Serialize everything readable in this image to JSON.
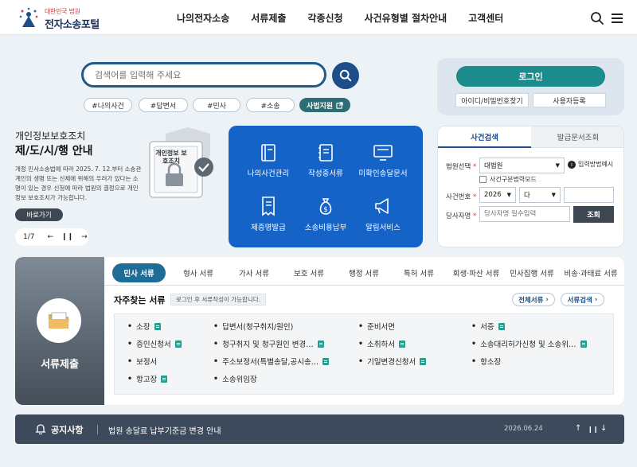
{
  "header": {
    "logo_sub": "대한민국 법원",
    "logo_main": "전자소송포털",
    "nav": [
      "나의전자소송",
      "서류제출",
      "각종신청",
      "사건유형별 절차안내",
      "고객센터"
    ]
  },
  "search": {
    "placeholder": "검색어를 입력해 주세요",
    "tags": [
      "#나의사건",
      "#답변서",
      "#민사",
      "#소송",
      "사법지원"
    ]
  },
  "login": {
    "button": "로그인",
    "find": "아이디/비밀번호찾기",
    "register": "사용자등록"
  },
  "promo": {
    "title1": "개인정보보호조치",
    "title2": "제/도/시/행 안내",
    "body": "개정 민사소송법에 따라 2025. 7. 12.부터 소송관계인의 생명 또는 신체에 위해의 우려가 있다는 소명이 있는 경우 신청에 따라 법원의 결정으로 개인정보 보호조치가 가능합니다.",
    "more": "바로가기",
    "page": "1/7",
    "card_label": "개인정보 보호조치"
  },
  "services": [
    "나의사건관리",
    "작성중서류",
    "미확인송달문서",
    "제증명발급",
    "소송비용납부",
    "알림서비스"
  ],
  "case_search": {
    "tab_active": "사건검색",
    "tab_inactive": "발급문서조회",
    "court_label": "법원선택",
    "court_value": "대법원",
    "input_method": "입력방법예시",
    "no_case_mode": "사건구분법력모드",
    "case_no_label": "사건번호",
    "year": "2026",
    "type": "다",
    "party_label": "당사자명",
    "party_placeholder": "당사자명 필수입력",
    "search_btn": "조회"
  },
  "documents": {
    "side_label": "서류제출",
    "tabs": [
      "민사 서류",
      "형사 서류",
      "가사 서류",
      "보호 서류",
      "행정 서류",
      "특허 서류",
      "회생·파산 서류",
      "민사집행 서류",
      "비송·과태료 서류"
    ],
    "faq_title": "자주찾는 서류",
    "faq_note": "로그인 후 서류작성이 가능합니다.",
    "all_docs": "전체서류",
    "doc_search": "서류검색",
    "items": [
      [
        "소장",
        "답변서(청구취지/원인)",
        "준비서면",
        "서증"
      ],
      [
        "증인신청서",
        "청구취지 및 청구원인 변경…",
        "소취하서",
        "소송대리허가신청 및 소송위…"
      ],
      [
        "보정서",
        "주소보정서(특별송달,공시송…",
        "기일변경신청서",
        "항소장"
      ],
      [
        "항고장",
        "소송위임장",
        "",
        ""
      ]
    ],
    "item_icons": [
      [
        true,
        false,
        false,
        true
      ],
      [
        true,
        true,
        true,
        true
      ],
      [
        false,
        true,
        true,
        false
      ],
      [
        true,
        false,
        false,
        false
      ]
    ]
  },
  "notice": {
    "title": "공지사항",
    "text": "법원 송달료 납부기준금 변경 안내",
    "date": "2026.06.24"
  }
}
